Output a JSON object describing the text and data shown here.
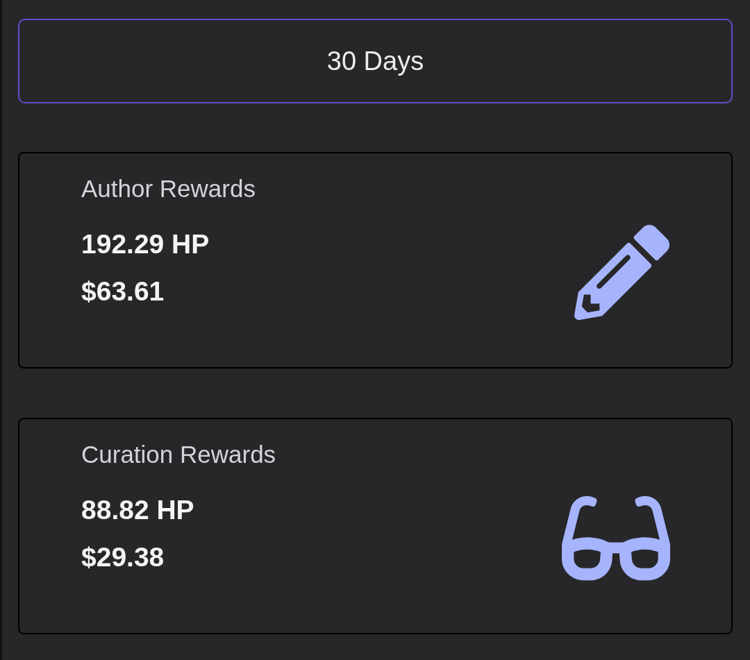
{
  "period_button": {
    "label": "30 Days"
  },
  "cards": [
    {
      "kind": "author",
      "title": "Author Rewards",
      "hp": "192.29 HP",
      "usd": "$63.61"
    },
    {
      "kind": "curation",
      "title": "Curation Rewards",
      "hp": "88.82 HP",
      "usd": "$29.38"
    }
  ]
}
